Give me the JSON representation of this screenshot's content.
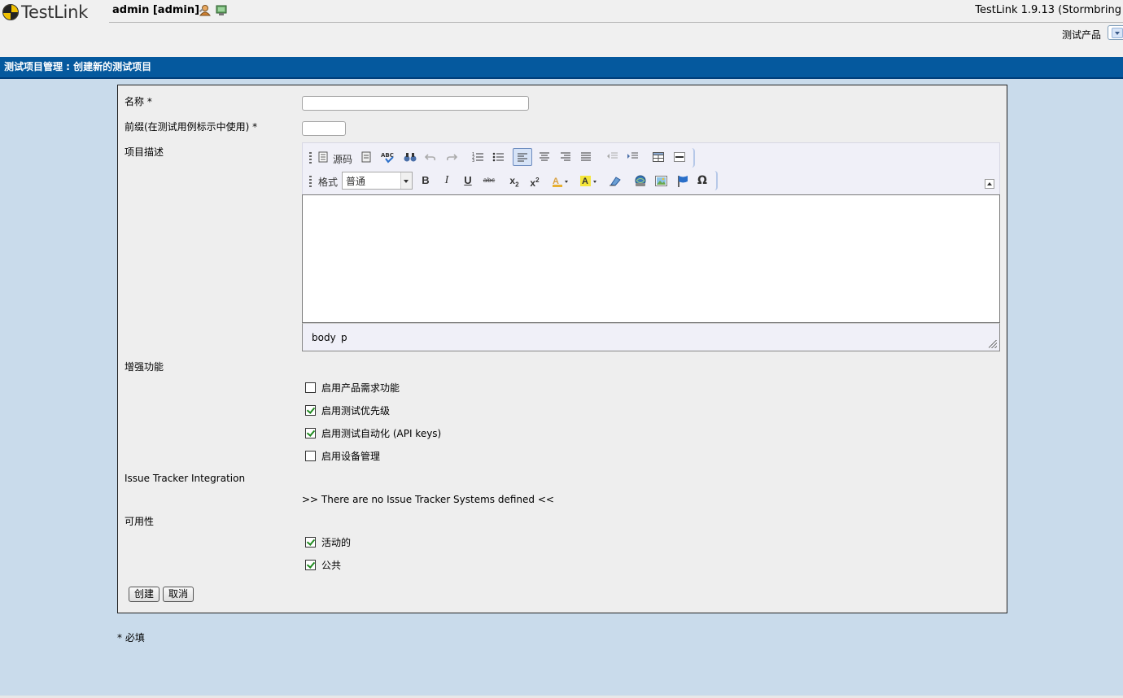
{
  "app": {
    "logo_text": "TestLink",
    "user": "admin [admin]",
    "version": "TestLink 1.9.13 (Stormbring",
    "project_label": "测试产品"
  },
  "page": {
    "title": "测试项目管理 : 创建新的测试项目"
  },
  "form": {
    "name_label": "名称 *",
    "name_value": "",
    "prefix_label": "前缀(在测试用例标示中使用) *",
    "prefix_value": "",
    "description_label": "项目描述",
    "editor": {
      "source_label": "源码",
      "format_label": "格式",
      "format_value": "普通",
      "path": [
        "body",
        "p"
      ]
    },
    "enhanced_label": "增强功能",
    "features": [
      {
        "label": "启用产品需求功能",
        "checked": false
      },
      {
        "label": "启用测试优先级",
        "checked": true
      },
      {
        "label": "启用测试自动化 (API keys)",
        "checked": true
      },
      {
        "label": "启用设备管理",
        "checked": false
      }
    ],
    "issue_tracker_label": "Issue Tracker Integration",
    "issue_tracker_msg": ">> There are no Issue Tracker Systems defined <<",
    "availability_label": "可用性",
    "availability": [
      {
        "label": "活动的",
        "checked": true
      },
      {
        "label": "公共",
        "checked": true
      }
    ],
    "create_button": "创建",
    "cancel_button": "取消"
  },
  "footer": {
    "required_note": "* 必填"
  },
  "colors": {
    "title_bar": "#05599e",
    "page_bg": "#c9dbeb",
    "form_bg": "#eeeeee"
  }
}
